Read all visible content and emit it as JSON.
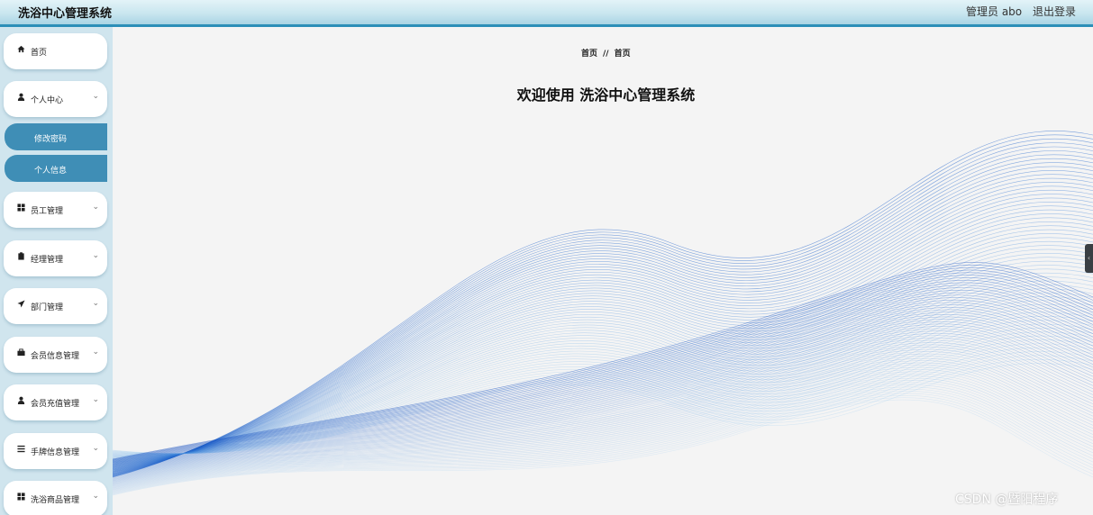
{
  "app": {
    "title": "洗浴中心管理系统"
  },
  "header": {
    "admin": "管理员 abo",
    "logout": "退出登录"
  },
  "sidebar": {
    "items": [
      {
        "label": "首页",
        "icon": "home-icon"
      },
      {
        "label": "个人中心",
        "icon": "user-icon"
      },
      {
        "label": "员工管理",
        "icon": "grid-icon"
      },
      {
        "label": "经理管理",
        "icon": "clipboard-icon"
      },
      {
        "label": "部门管理",
        "icon": "paper-plane-icon"
      },
      {
        "label": "会员信息管理",
        "icon": "briefcase-icon"
      },
      {
        "label": "会员充值管理",
        "icon": "user-icon"
      },
      {
        "label": "手牌信息管理",
        "icon": "list-icon"
      },
      {
        "label": "洗浴商品管理",
        "icon": "grid-icon"
      }
    ],
    "subitems": [
      {
        "label": "修改密码"
      },
      {
        "label": "个人信息"
      }
    ]
  },
  "breadcrumb": {
    "first": "首页",
    "separator": "//",
    "second": "首页"
  },
  "main": {
    "welcome": "欢迎使用 洗浴中心管理系统"
  },
  "watermark": "CSDN @暨阳程序",
  "colors": {
    "accent": "#3f8eb6",
    "sidebar_bg": "#d0e5ee",
    "wave": "#1f6fc4"
  }
}
